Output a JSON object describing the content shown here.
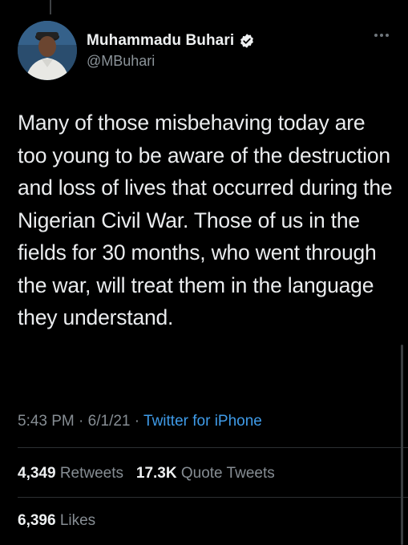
{
  "tweet": {
    "author_name": "Muhammadu Buhari",
    "handle": "@MBuhari",
    "text": "Many of those misbehaving today are too young to be aware of the destruction and loss of lives that occurred during the Nigerian Civil War. Those of us in the fields for 30 months, who went through the war, will treat them in the language they understand.",
    "time": "5:43 PM",
    "date": "6/1/21",
    "separator": "·",
    "source": "Twitter for iPhone"
  },
  "stats": {
    "retweets_count": "4,349",
    "retweets_label": "Retweets",
    "quote_tweets_count": "17.3K",
    "quote_tweets_label": "Quote Tweets",
    "likes_count": "6,396",
    "likes_label": "Likes"
  },
  "icons": {
    "verified": "verified-badge-icon",
    "more": "more-options-icon"
  },
  "colors": {
    "background": "#000000",
    "link": "#3f9be8",
    "secondary_text": "#868d93"
  }
}
